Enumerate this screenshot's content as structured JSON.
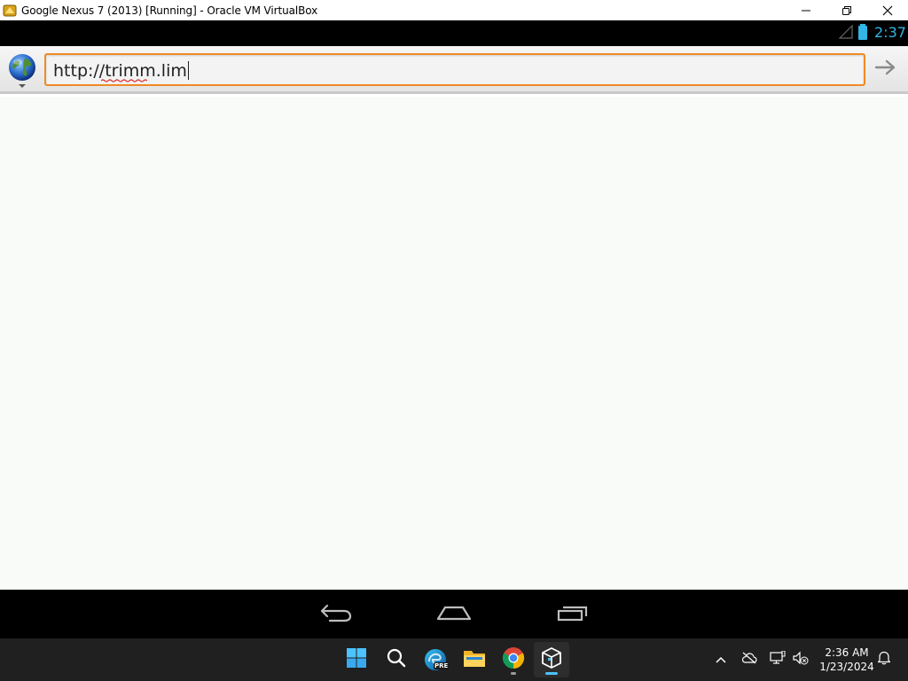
{
  "window": {
    "title": "Google Nexus 7 (2013) [Running] - Oracle VM VirtualBox",
    "controls": [
      "minimize",
      "restore",
      "close"
    ]
  },
  "android_status": {
    "clock": "2:37",
    "icons": [
      "signal-icon",
      "battery-icon"
    ],
    "clock_color": "#33b5e5"
  },
  "browser": {
    "url_value": "http://trimm.lim",
    "url_focus_color": "#f08a24",
    "globe_icon": "globe-icon",
    "go_icon": "arrow-right-icon"
  },
  "android_nav": {
    "buttons": [
      "back-icon",
      "home-icon",
      "recent-apps-icon"
    ]
  },
  "taskbar": {
    "apps": [
      "start-icon",
      "search-icon",
      "edge-beta-icon",
      "file-explorer-icon",
      "chrome-icon",
      "virtualbox-icon"
    ],
    "edge_badge": "PRE",
    "tray": [
      "chevron-up-icon",
      "cloud-offline-icon",
      "network-icon",
      "volume-muted-icon",
      "notification-bell-icon"
    ],
    "time": "2:36 AM",
    "date": "1/23/2024"
  }
}
